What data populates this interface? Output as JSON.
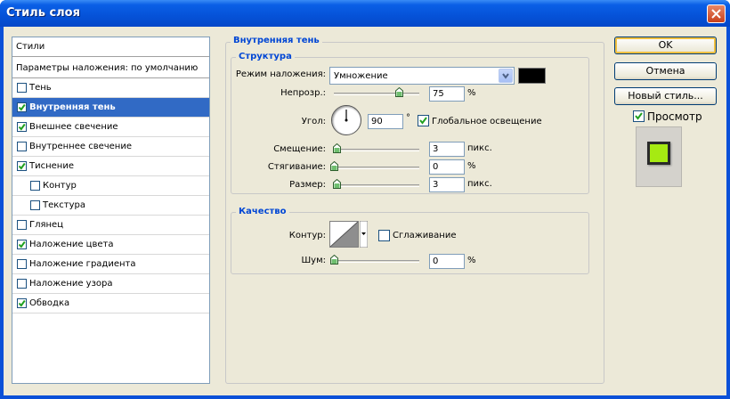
{
  "window": {
    "title": "Стиль слоя"
  },
  "styles_list": {
    "header": "Стили",
    "blend_defaults": "Параметры наложения: по умолчанию",
    "items": [
      {
        "label": "Тень",
        "checked": false,
        "indent": false,
        "selected": false
      },
      {
        "label": "Внутренняя тень",
        "checked": true,
        "indent": false,
        "selected": true
      },
      {
        "label": "Внешнее свечение",
        "checked": true,
        "indent": false,
        "selected": false
      },
      {
        "label": "Внутреннее свечение",
        "checked": false,
        "indent": false,
        "selected": false
      },
      {
        "label": "Тиснение",
        "checked": true,
        "indent": false,
        "selected": false
      },
      {
        "label": "Контур",
        "checked": false,
        "indent": true,
        "selected": false
      },
      {
        "label": "Текстура",
        "checked": false,
        "indent": true,
        "selected": false
      },
      {
        "label": "Глянец",
        "checked": false,
        "indent": false,
        "selected": false
      },
      {
        "label": "Наложение цвета",
        "checked": true,
        "indent": false,
        "selected": false
      },
      {
        "label": "Наложение градиента",
        "checked": false,
        "indent": false,
        "selected": false
      },
      {
        "label": "Наложение узора",
        "checked": false,
        "indent": false,
        "selected": false
      },
      {
        "label": "Обводка",
        "checked": true,
        "indent": false,
        "selected": false
      }
    ]
  },
  "inner_shadow": {
    "title": "Внутренняя тень",
    "structure": {
      "title": "Структура",
      "blend_mode_label": "Режим наложения:",
      "blend_mode_value": "Умножение",
      "shadow_color": "#000000",
      "opacity_label": "Непрозр.:",
      "opacity_value": "75",
      "opacity_unit": "%",
      "angle_label": "Угол:",
      "angle_value": "90",
      "angle_unit": "°",
      "global_light_label": "Глобальное освещение",
      "global_light_checked": true,
      "distance_label": "Смещение:",
      "distance_value": "3",
      "distance_unit": "пикс.",
      "choke_label": "Стягивание:",
      "choke_value": "0",
      "choke_unit": "%",
      "size_label": "Размер:",
      "size_value": "3",
      "size_unit": "пикс."
    },
    "quality": {
      "title": "Качество",
      "contour_label": "Контур:",
      "antialias_label": "Сглаживание",
      "antialias_checked": false,
      "noise_label": "Шум:",
      "noise_value": "0",
      "noise_unit": "%"
    }
  },
  "buttons": {
    "ok": "OK",
    "cancel": "Отмена",
    "new_style": "Новый стиль...",
    "preview_label": "Просмотр",
    "preview_checked": true
  },
  "preview_color": "#a6ea12"
}
